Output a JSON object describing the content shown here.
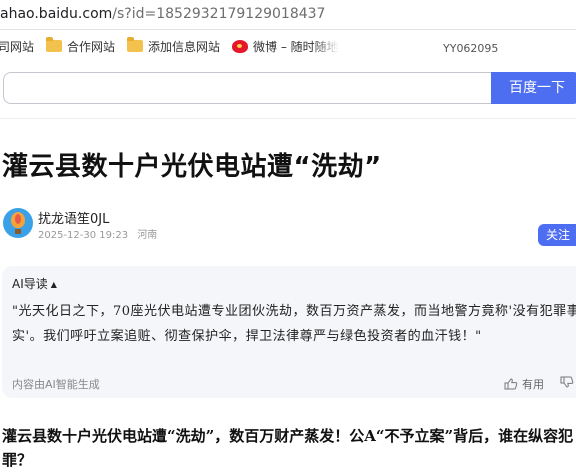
{
  "browser": {
    "url_host": "ahao.baidu.com",
    "url_path": "/s?id=1852932179129018437",
    "bookmarks": [
      {
        "label": "公司网站",
        "icon": "folder-icon"
      },
      {
        "label": "合作网站",
        "icon": "folder-icon"
      },
      {
        "label": "添加信息网站",
        "icon": "folder-icon"
      },
      {
        "label": "微博 – 随时随地",
        "icon": "weibo-icon"
      }
    ],
    "extra_label": "YY062095"
  },
  "search": {
    "placeholder": "",
    "button_label": "百度一下"
  },
  "article": {
    "title": "灌云县数十户光伏电站遭“洗劫”",
    "author": "扰龙语笙0JL",
    "timestamp": "2025-12-30 19:23",
    "location": "河南",
    "follow_label": "关注"
  },
  "ai_summary": {
    "heading": "AI导读",
    "text": "\"光天化日之下，70座光伏电站遭专业团伙洗劫，数百万资产蒸发，而当地警方竟称'没有犯罪事实'。我们呼吁立案追赃、彻查保护伞，捍卫法律尊严与绿色投资者的血汗钱！\"",
    "footer": "内容由AI智能生成",
    "useful_label": "有用"
  },
  "body": {
    "first_paragraph": "灌云县数十户光伏电站遭“洗劫”，数百万财产蒸发！公A“不予立案”背后，谁在纵容犯罪？"
  },
  "colors": {
    "accent": "#4e6ef2",
    "card_bg": "#f5f6f9"
  }
}
